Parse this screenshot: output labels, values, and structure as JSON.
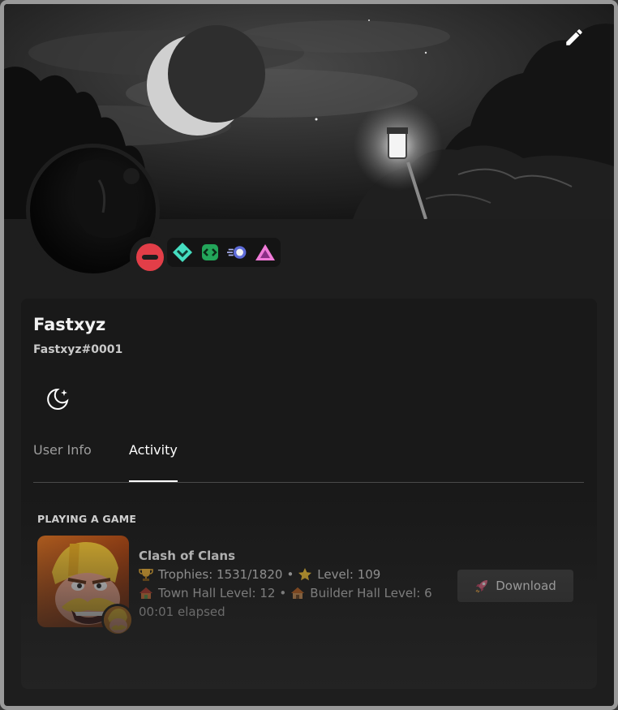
{
  "profile": {
    "username": "Fastxyz",
    "tag": "Fastxyz#0001",
    "status": "do-not-disturb",
    "custom_status_icon": "moon-star-icon",
    "badges": [
      "hypesquad-balance-icon",
      "active-developer-icon",
      "nitro-boost-icon",
      "nitro-pink-icon"
    ]
  },
  "banner": {
    "edit_icon": "pencil-icon"
  },
  "tabs": [
    {
      "label": "User Info",
      "active": false
    },
    {
      "label": "Activity",
      "active": true
    }
  ],
  "activity": {
    "section_title": "PLAYING A GAME",
    "game_name": "Clash of Clans",
    "trophies_label": "Trophies: 1531/1820",
    "level_label": "Level: 109",
    "town_hall_label": "Town Hall Level: 12",
    "builder_hall_label": "Builder Hall Level: 6",
    "elapsed": "00:01 elapsed",
    "separator": "•",
    "download_label": "Download",
    "icons": {
      "trophy": "trophy-icon",
      "star": "star-icon",
      "town_hall": "house-icon",
      "builder_hall": "house-icon",
      "download": "rocket-icon"
    }
  },
  "colors": {
    "card_bg": "#191919",
    "frame_border": "#9a9a9a",
    "dnd_red": "#e23e48",
    "button_bg": "#3c3c3c"
  }
}
